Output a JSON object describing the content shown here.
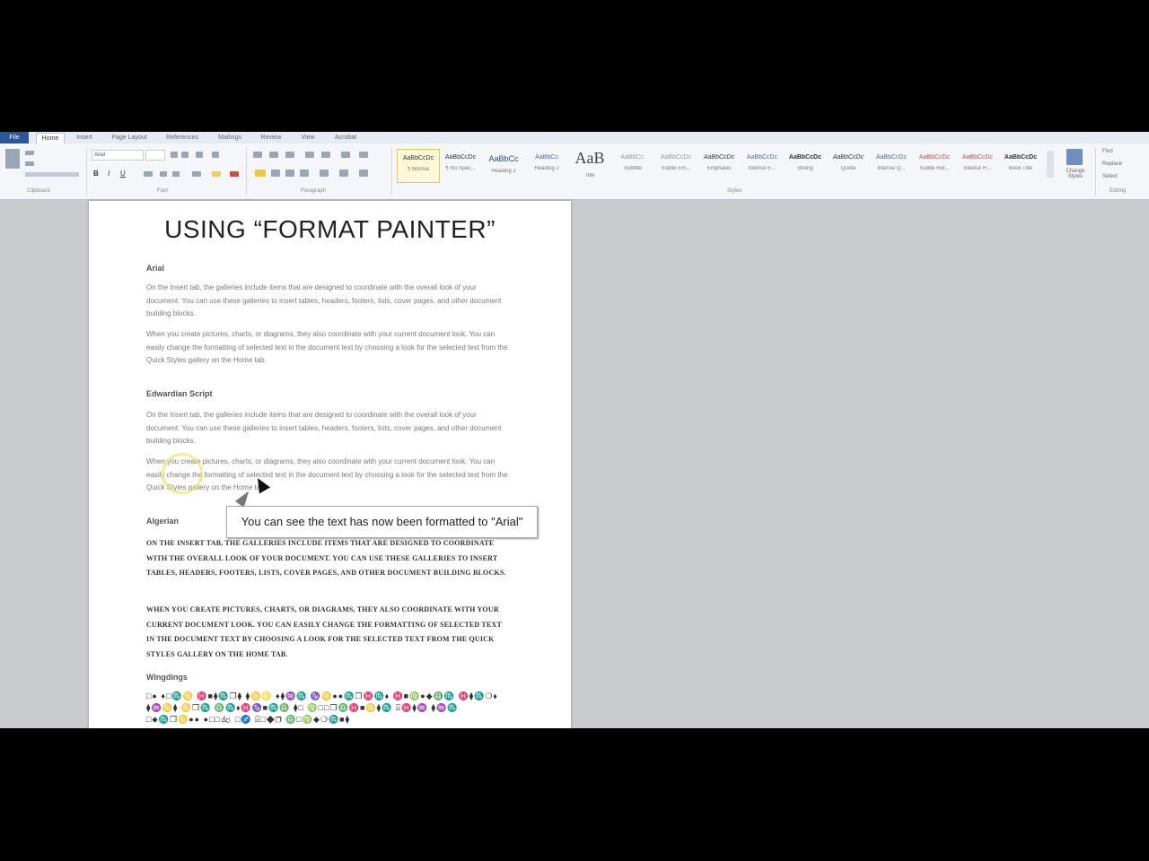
{
  "ribbon": {
    "tabs": [
      "File",
      "Home",
      "Insert",
      "Page Layout",
      "References",
      "Mailings",
      "Review",
      "View",
      "Acrobat"
    ],
    "groups": [
      "Clipboard",
      "Font",
      "Paragraph",
      "Styles",
      "Editing"
    ],
    "font_name": "Arial",
    "styles": [
      {
        "sample": "AaBbCcDc",
        "name": "¶ Normal"
      },
      {
        "sample": "AaBbCcDc",
        "name": "¶ No Spac..."
      },
      {
        "sample": "AaBbCc",
        "name": "Heading 1"
      },
      {
        "sample": "AaBbCc",
        "name": "Heading 2"
      },
      {
        "sample": "AaB",
        "name": "Title"
      },
      {
        "sample": "AaBbCc.",
        "name": "Subtitle"
      },
      {
        "sample": "AaBbCcDc",
        "name": "Subtle Em..."
      },
      {
        "sample": "AaBbCcDc",
        "name": "Emphasis"
      },
      {
        "sample": "AaBbCcDc",
        "name": "Intense E..."
      },
      {
        "sample": "AaBbCcDc",
        "name": "Strong"
      },
      {
        "sample": "AaBbCcDc",
        "name": "Quote"
      },
      {
        "sample": "AaBbCcDc",
        "name": "Intense Q..."
      },
      {
        "sample": "AaBbCcDc",
        "name": "Subtle Ref..."
      },
      {
        "sample": "AaBbCcDc",
        "name": "Intense R..."
      },
      {
        "sample": "AaBbCcDc",
        "name": "Book Title"
      }
    ],
    "change_styles": "Change Styles",
    "editing": [
      "Find",
      "Replace",
      "Select"
    ]
  },
  "document": {
    "title": "USING “FORMAT PAINTER”",
    "sections": [
      {
        "heading": "Arial",
        "paragraphs": [
          "On the Insert tab, the galleries include items that are designed to coordinate with the overall look of your document. You can use these galleries to insert tables, headers, footers, lists, cover pages, and other document building blocks.",
          "When you create pictures, charts, or diagrams, they also coordinate with your current document look. You can easily change the formatting of selected text in the document text by choosing a look for the selected text from the Quick Styles gallery on the Home tab."
        ]
      },
      {
        "heading": "Edwardian Script",
        "paragraphs": [
          "On the Insert tab, the galleries include items that are designed to coordinate with the overall look of your document. You can use these galleries to insert tables, headers, footers, lists, cover pages, and other document building blocks.",
          "When you create pictures, charts, or diagrams, they also coordinate with your current document look. You can easily change the formatting of selected text in the document text by choosing a look for the selected text from the Quick Styles gallery on the Home tab."
        ]
      },
      {
        "heading": "Algerian",
        "paragraphs": [
          "On the Insert tab, the galleries include items that are designed to coordinate with the overall look of your document. You can use these galleries to insert tables, headers, footers, lists, cover pages, and other document building blocks.",
          "When you create pictures, charts, or diagrams, they also coordinate with your current document look. You can easily change the formatting of selected text in the document text by choosing a look for the selected text from the Quick Styles gallery on the Home tab."
        ]
      },
      {
        "heading": "Wingdings",
        "paragraphs": [
          "□● ♦□♏♋ ♓■⧫♏❒⧫ ⧫♋♌ ♦⧫♒♏ ♑♋●●♏❒♓♏⬧ ♓■♍●◆♎♏ ♓⧫♏❍⬧ ⧫♒♋⧫ ♋❒♏ ♎♏⬧♓♑■♏♎ ⧫□ ♍□□❒♎♓■♋⧫♏ ⍓♓⧫♒ ⧫♒♏ □⬥♏❒♋●● ●□□🙵 □♐ ⍓□◆❒ ♎□♍◆❍♏■⧫"
        ]
      }
    ]
  },
  "callout": {
    "text": "You can see the text has now been formatted to \"Arial\""
  }
}
